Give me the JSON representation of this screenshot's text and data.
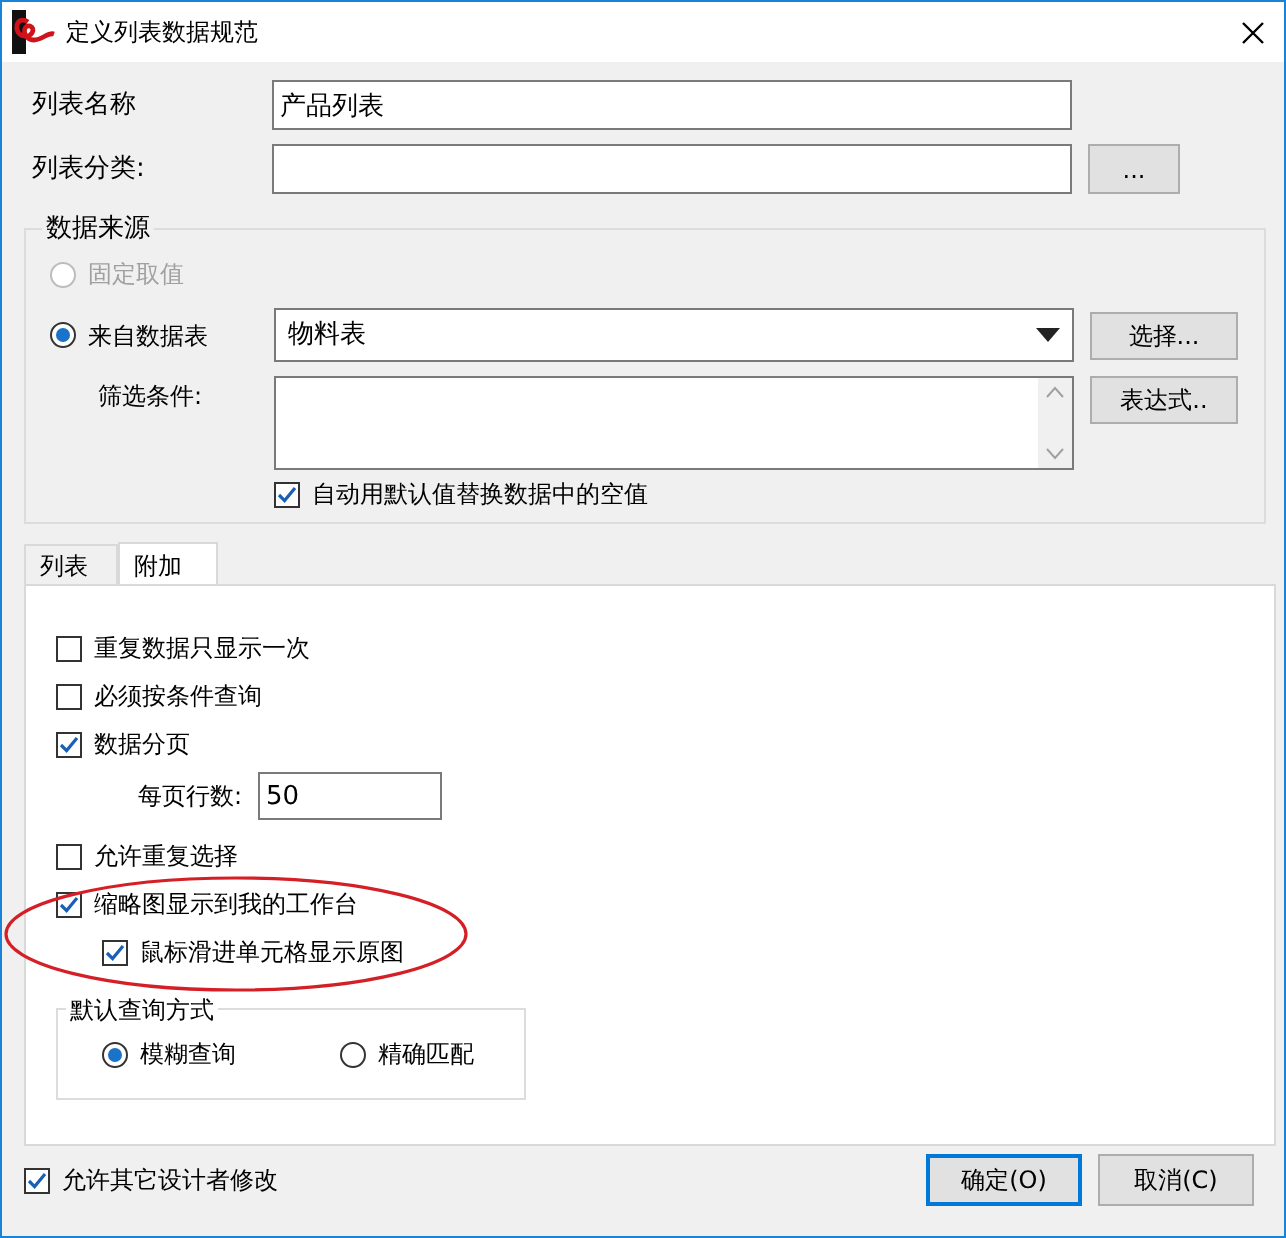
{
  "window": {
    "title": "定义列表数据规范"
  },
  "fields": [
    {
      "label": "列表名称",
      "value": "产品列表"
    },
    {
      "label": "列表分类:",
      "button": "..."
    }
  ],
  "data_source": {
    "title": "数据来源",
    "options": [
      {
        "label": "固定取值",
        "selected": false,
        "disabled": true
      },
      {
        "label": "来自数据表",
        "selected": true,
        "disabled": false
      }
    ],
    "table": {
      "value": "物料表",
      "button": "选择..."
    },
    "filter": {
      "label": "筛选条件:",
      "button": "表达式.."
    },
    "replace_nulls": {
      "label": "自动用默认值替换数据中的空值",
      "checked": true
    }
  },
  "tabs": [
    {
      "label": "列表",
      "selected": false
    },
    {
      "label": "附加",
      "selected": true
    }
  ],
  "options": [
    {
      "kind": "checkbox",
      "label": "重复数据只显示一次",
      "checked": false
    },
    {
      "kind": "checkbox",
      "label": "必须按条件查询",
      "checked": false
    },
    {
      "kind": "checkbox",
      "label": "数据分页",
      "checked": true,
      "children": [
        {
          "kind": "number",
          "label": "每页行数:",
          "value": "50"
        }
      ]
    },
    {
      "kind": "checkbox",
      "label": "允许重复选择",
      "checked": false
    },
    {
      "kind": "checkbox",
      "label": "缩略图显示到我的工作台",
      "checked": true,
      "highlight": true,
      "children": [
        {
          "kind": "checkbox",
          "label": "鼠标滑进单元格显示原图",
          "checked": true
        }
      ]
    }
  ],
  "query_mode": {
    "title": "默认查询方式",
    "options": [
      {
        "label": "模糊查询",
        "selected": true
      },
      {
        "label": "精确匹配",
        "selected": false
      }
    ]
  },
  "allow_edit": {
    "label": "允许其它设计者修改",
    "checked": true
  },
  "buttons": [
    {
      "label": "确定(O)",
      "default": true
    },
    {
      "label": "取消(C)",
      "default": false
    }
  ]
}
